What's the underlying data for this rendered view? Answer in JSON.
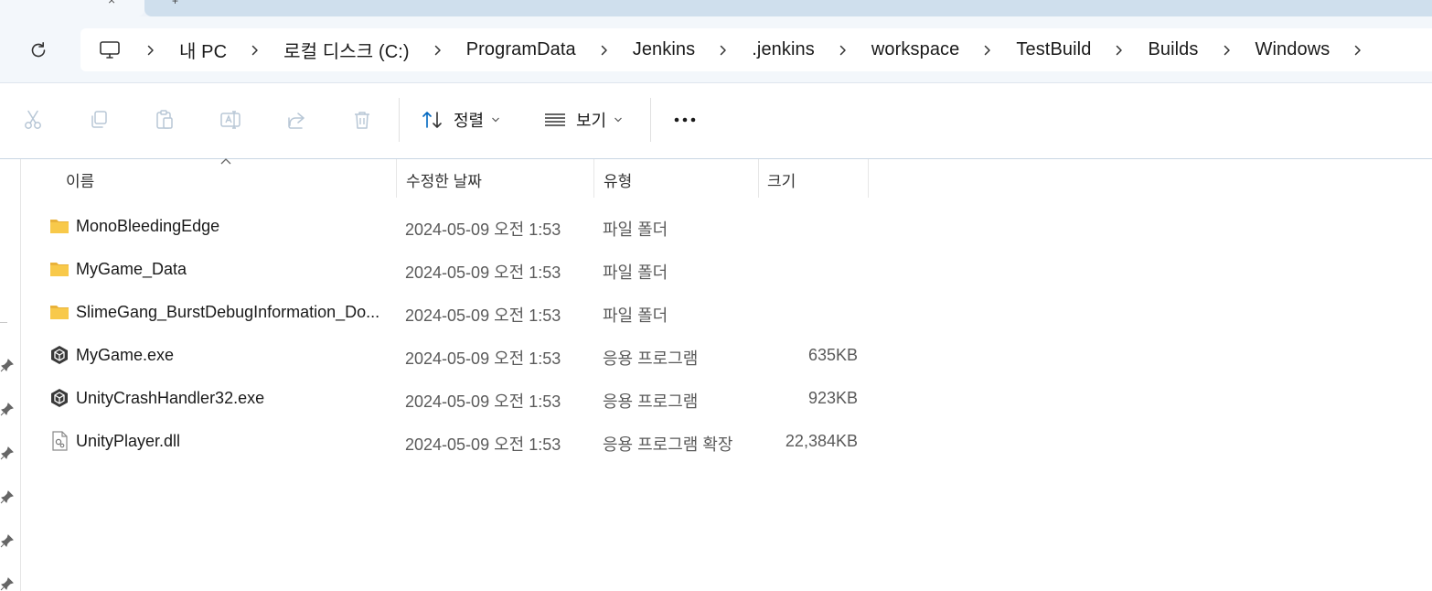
{
  "window": {
    "tab_close_glyph": "×",
    "next_tab_glyph": "+"
  },
  "address_bar": {
    "breadcrumbs": [
      "내 PC",
      "로컬 디스크 (C:)",
      "ProgramData",
      "Jenkins",
      ".jenkins",
      "workspace",
      "TestBuild",
      "Builds",
      "Windows"
    ]
  },
  "toolbar": {
    "sort_label": "정렬",
    "view_label": "보기",
    "buttons": [
      "cut-icon",
      "copy-icon",
      "paste-icon",
      "rename-icon",
      "share-icon",
      "delete-icon"
    ],
    "more_icon": "ellipsis-icon"
  },
  "columns": {
    "name": "이름",
    "date": "수정한 날짜",
    "type": "유형",
    "size": "크기"
  },
  "files": [
    {
      "name": "MonoBleedingEdge",
      "date": "2024-05-09 오전 1:53",
      "type": "파일 폴더",
      "size": "",
      "icon": "folder-icon"
    },
    {
      "name": "MyGame_Data",
      "date": "2024-05-09 오전 1:53",
      "type": "파일 폴더",
      "size": "",
      "icon": "folder-icon"
    },
    {
      "name": "SlimeGang_BurstDebugInformation_Do...",
      "date": "2024-05-09 오전 1:53",
      "type": "파일 폴더",
      "size": "",
      "icon": "folder-icon"
    },
    {
      "name": "MyGame.exe",
      "date": "2024-05-09 오전 1:53",
      "type": "응용 프로그램",
      "size": "635KB",
      "icon": "unity-icon"
    },
    {
      "name": "UnityCrashHandler32.exe",
      "date": "2024-05-09 오전 1:53",
      "type": "응용 프로그램",
      "size": "923KB",
      "icon": "unity-icon"
    },
    {
      "name": "UnityPlayer.dll",
      "date": "2024-05-09 오전 1:53",
      "type": "응용 프로그램 확장",
      "size": "22,384KB",
      "icon": "dll-file-icon"
    }
  ],
  "colors": {
    "accent": "#0067c0",
    "folder": "#f8c94a",
    "disabled_icon": "#b8c7d6"
  }
}
